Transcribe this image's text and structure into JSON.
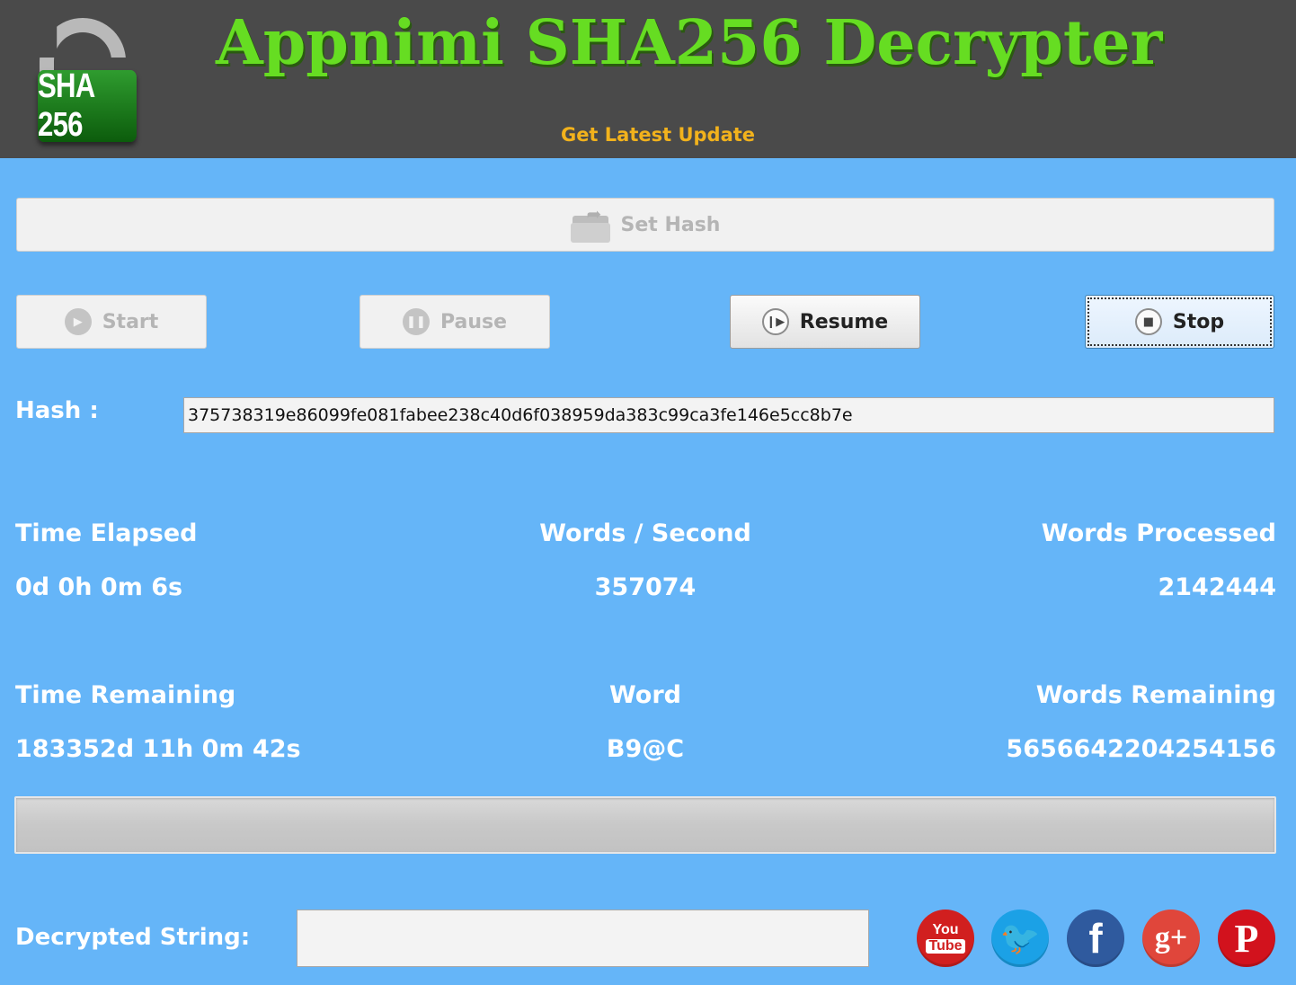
{
  "app": {
    "title": "Appnimi SHA256 Decrypter",
    "logo_text": "SHA 256",
    "update_link": "Get Latest Update"
  },
  "colors": {
    "background": "#65b5f8",
    "header": "#4a4a4a",
    "title": "#66dd22",
    "update_link": "#f2b21c"
  },
  "toolbar": {
    "set_hash": {
      "label": "Set Hash",
      "enabled": false
    },
    "start": {
      "label": "Start",
      "enabled": false
    },
    "pause": {
      "label": "Pause",
      "enabled": false
    },
    "resume": {
      "label": "Resume",
      "enabled": true
    },
    "stop": {
      "label": "Stop",
      "enabled": true,
      "focused": true
    }
  },
  "hash": {
    "label": "Hash :",
    "value": "375738319e86099fe081fabee238c40d6f038959da383c99ca3fe146e5cc8b7e"
  },
  "stats": {
    "time_elapsed": {
      "label": "Time Elapsed",
      "value": "0d 0h 0m 6s"
    },
    "words_per_second": {
      "label": "Words / Second",
      "value": "357074"
    },
    "words_processed": {
      "label": "Words Processed",
      "value": "2142444"
    },
    "time_remaining": {
      "label": "Time Remaining",
      "value": "183352d 11h 0m 42s"
    },
    "word": {
      "label": "Word",
      "value": "B9@C"
    },
    "words_remaining": {
      "label": "Words Remaining",
      "value": "5656642204254156"
    }
  },
  "progress": {
    "percent": 0
  },
  "decrypted": {
    "label": "Decrypted String:",
    "value": ""
  },
  "social": {
    "youtube": {
      "icon": "youtube-icon",
      "line1": "You",
      "line2": "Tube"
    },
    "twitter": {
      "icon": "twitter-icon",
      "glyph": "🐦"
    },
    "facebook": {
      "icon": "facebook-icon",
      "glyph": "f"
    },
    "googleplus": {
      "icon": "google-plus-icon",
      "glyph": "g+"
    },
    "pinterest": {
      "icon": "pinterest-icon",
      "glyph": "P"
    }
  }
}
